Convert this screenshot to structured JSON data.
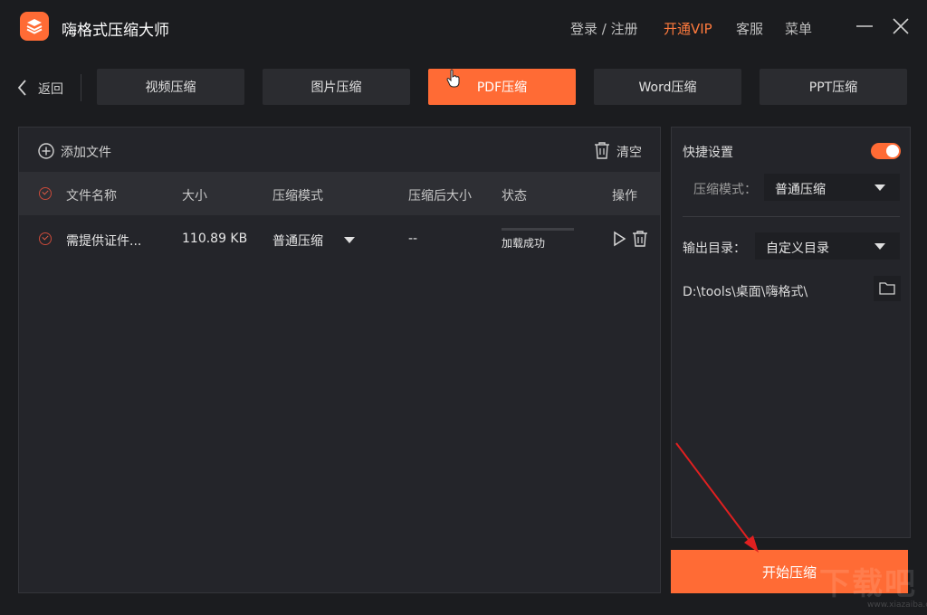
{
  "app": {
    "title": "嗨格式压缩大师"
  },
  "titlebar": {
    "login_label": "登录 / 注册",
    "vip_label": "开通VIP",
    "service_label": "客服",
    "menu_label": "菜单"
  },
  "nav": {
    "back_label": "返回",
    "tabs": [
      {
        "label": "视频压缩"
      },
      {
        "label": "图片压缩"
      },
      {
        "label": "PDF压缩"
      },
      {
        "label": "Word压缩"
      },
      {
        "label": "PPT压缩"
      }
    ],
    "active_tab": "PDF压缩"
  },
  "files": {
    "add_label": "添加文件",
    "clear_label": "清空",
    "columns": [
      "文件名称",
      "大小",
      "压缩模式",
      "压缩后大小",
      "状态",
      "操作"
    ],
    "rows": [
      {
        "name": "需提供证件...",
        "size": "110.89 KB",
        "mode": "普通压缩",
        "compressed_size": "--",
        "status": "加载成功"
      }
    ]
  },
  "settings": {
    "quick_label": "快捷设置",
    "quick_enabled": true,
    "mode_label": "压缩模式：",
    "mode_value": "普通压缩",
    "output_label": "输出目录：",
    "output_value": "自定义目录",
    "output_path": "D:\\tools\\桌面\\嗨格式\\"
  },
  "actions": {
    "start_label": "开始压缩"
  },
  "watermark": {
    "main": "下载吧",
    "sub": "www.xiazaiba.com"
  },
  "colors": {
    "accent": "#ff6b35",
    "vip": "#ff7a3d",
    "panel": "#24252a",
    "annotation_arrow": "#e02020"
  }
}
